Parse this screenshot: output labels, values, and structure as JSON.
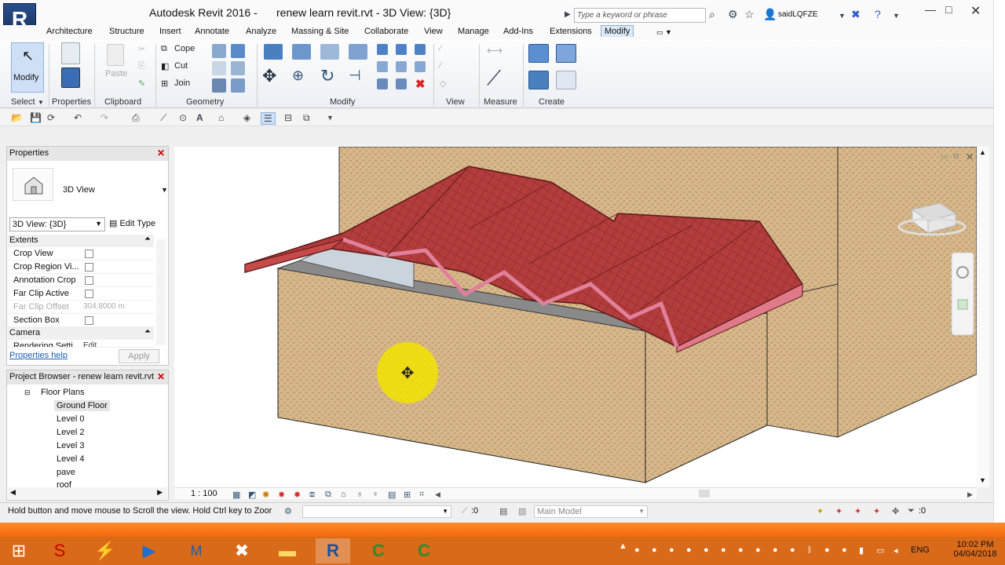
{
  "app": {
    "title": "Autodesk Revit 2016 -",
    "document": "renew learn revit.rvt - 3D View: {3D}"
  },
  "search": {
    "placeholder": "Type a keyword or phrase"
  },
  "user": {
    "name": "saidLQFZE"
  },
  "tabs": [
    "Architecture",
    "Structure",
    "Insert",
    "Annotate",
    "Analyze",
    "Massing & Site",
    "Collaborate",
    "View",
    "Manage",
    "Add-Ins",
    "Extensions",
    "Modify"
  ],
  "active_tab": "Modify",
  "ribbon": {
    "modify_label": "Modify",
    "paste_label": "Paste",
    "cope_label": "Cope",
    "cut_label": "Cut",
    "join_label": "Join",
    "panels": {
      "select": "Select",
      "properties": "Properties",
      "clipboard": "Clipboard",
      "geometry": "Geometry",
      "modify": "Modify",
      "view": "View",
      "measure": "Measure",
      "create": "Create"
    }
  },
  "properties": {
    "title": "Properties",
    "type_name": "3D View",
    "view_selector": "3D View: {3D}",
    "edit_type": "Edit Type",
    "groups": {
      "extents": "Extents",
      "camera": "Camera"
    },
    "rows": [
      {
        "label": "Crop View",
        "checked": false
      },
      {
        "label": "Crop Region Vi...",
        "checked": false
      },
      {
        "label": "Annotation Crop",
        "checked": false
      },
      {
        "label": "Far Clip Active",
        "checked": false
      },
      {
        "label": "Far Clip Offset",
        "value": "304.8000 m"
      },
      {
        "label": "Section Box",
        "checked": false
      }
    ],
    "camera_row": {
      "label": "Rendering Setti",
      "value": "Edit..."
    },
    "help": "Properties help",
    "apply": "Apply"
  },
  "project_browser": {
    "title": "Project Browser - renew learn revit.rvt",
    "root": "Floor Plans",
    "items": [
      "Ground Floor",
      "Level 0",
      "Level 2",
      "Level 3",
      "Level 4",
      "pave",
      "roof"
    ],
    "selected": "Ground Floor"
  },
  "view_bar": {
    "scale": "1 : 100"
  },
  "status": {
    "hint": "Hold button and move mouse to Scroll the view. Hold Ctrl key to Zoor",
    "selection_count": ":0",
    "model": "Main Model",
    "filter_count": ":0"
  },
  "taskbar": {
    "lang": "ENG",
    "time": "10:02 PM",
    "date": "04/04/2018"
  },
  "colors": {
    "roof": "#b23b3b",
    "wall": "#d9b98a",
    "accent": "#2b5797",
    "taskbar": "#d96a1a"
  }
}
